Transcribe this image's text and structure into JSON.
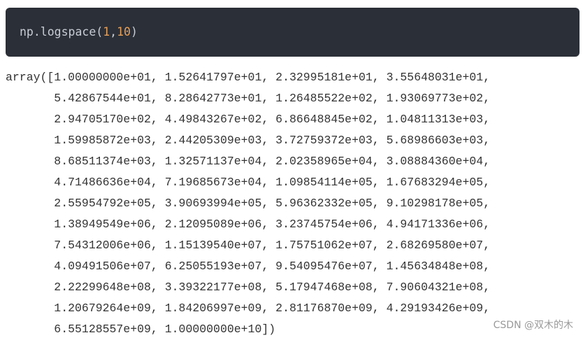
{
  "code_cell": {
    "func": "np.logspace",
    "open_paren": "(",
    "arg1": "1",
    "comma": ",",
    "arg2": "10",
    "close_paren": ")"
  },
  "output": {
    "lines": [
      "array([1.00000000e+01, 1.52641797e+01, 2.32995181e+01, 3.55648031e+01,",
      "       5.42867544e+01, 8.28642773e+01, 1.26485522e+02, 1.93069773e+02,",
      "       2.94705170e+02, 4.49843267e+02, 6.86648845e+02, 1.04811313e+03,",
      "       1.59985872e+03, 2.44205309e+03, 3.72759372e+03, 5.68986603e+03,",
      "       8.68511374e+03, 1.32571137e+04, 2.02358965e+04, 3.08884360e+04,",
      "       4.71486636e+04, 7.19685673e+04, 1.09854114e+05, 1.67683294e+05,",
      "       2.55954792e+05, 3.90693994e+05, 5.96362332e+05, 9.10298178e+05,",
      "       1.38949549e+06, 2.12095089e+06, 3.23745754e+06, 4.94171336e+06,",
      "       7.54312006e+06, 1.15139540e+07, 1.75751062e+07, 2.68269580e+07,",
      "       4.09491506e+07, 6.25055193e+07, 9.54095476e+07, 1.45634848e+08,",
      "       2.22299648e+08, 3.39322177e+08, 5.17947468e+08, 7.90604321e+08,",
      "       1.20679264e+09, 1.84206997e+09, 2.81176870e+09, 4.29193426e+09,",
      "       6.55128557e+09, 1.00000000e+10])"
    ]
  },
  "watermark": "CSDN @双木的木",
  "colors": {
    "code_bg": "#2b2f37",
    "code_text": "#c8ccd4",
    "code_number": "#e5a05b",
    "output_text": "#333333",
    "watermark": "#999999"
  }
}
